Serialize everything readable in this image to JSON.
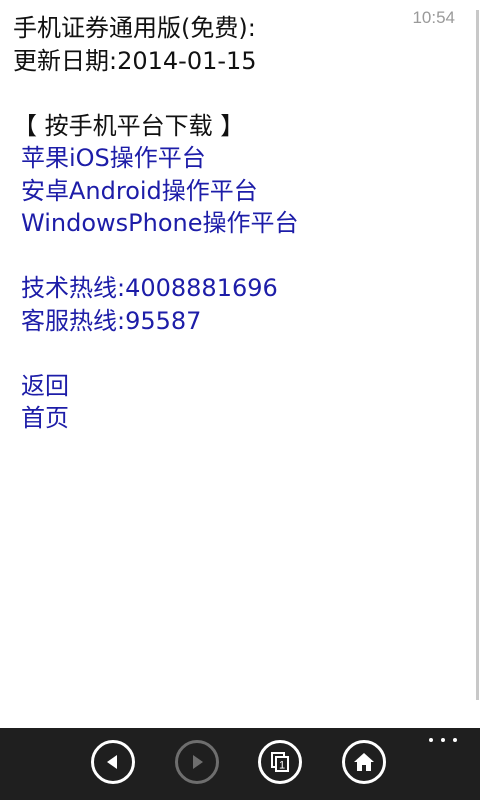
{
  "status_bar": {
    "time": "10:54"
  },
  "page": {
    "title": "手机证券通用版(免费):",
    "update_date": "更新日期:2014-01-15",
    "download_heading": "【 按手机平台下载 】",
    "platform_links": [
      "苹果iOS操作平台",
      "安卓Android操作平台",
      "WindowsPhone操作平台"
    ],
    "tech_hotline": "技术热线:4008881696",
    "service_hotline": "客服热线:95587",
    "back_link": "返回",
    "home_link": "首页"
  },
  "app_bar": {
    "buttons": [
      {
        "name": "back",
        "icon": "triangle-left-icon",
        "enabled": true
      },
      {
        "name": "forward",
        "icon": "triangle-right-icon",
        "enabled": false
      },
      {
        "name": "tabs",
        "icon": "tabs-icon",
        "badge": "1",
        "enabled": true
      },
      {
        "name": "home",
        "icon": "home-icon",
        "enabled": true
      }
    ],
    "more": "ellipsis-icon"
  },
  "colors": {
    "link": "#1d1da8",
    "text": "#111111",
    "app_bar_bg": "#1f1f1f",
    "disabled": "#6e6e6e"
  }
}
